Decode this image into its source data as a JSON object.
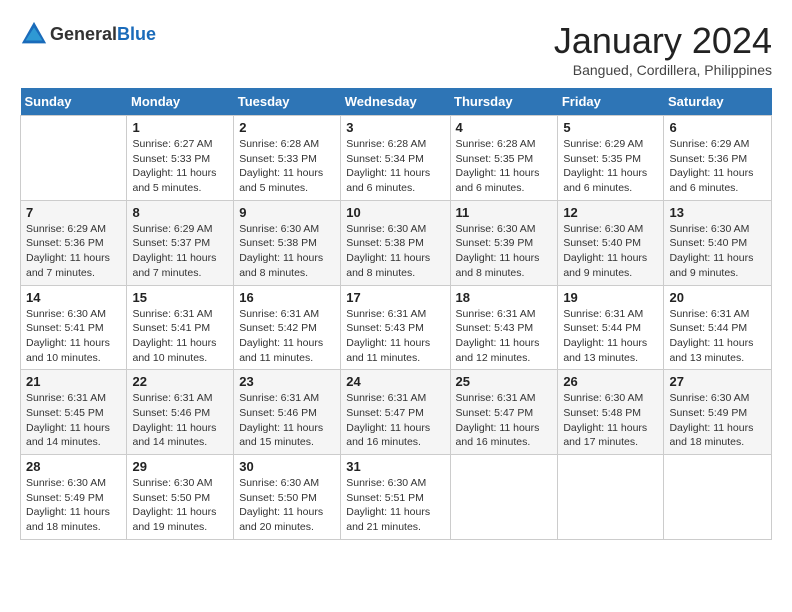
{
  "header": {
    "logo_general": "General",
    "logo_blue": "Blue",
    "month_year": "January 2024",
    "location": "Bangued, Cordillera, Philippines"
  },
  "weekdays": [
    "Sunday",
    "Monday",
    "Tuesday",
    "Wednesday",
    "Thursday",
    "Friday",
    "Saturday"
  ],
  "weeks": [
    [
      {
        "day": "",
        "sunrise": "",
        "sunset": "",
        "daylight": ""
      },
      {
        "day": "1",
        "sunrise": "Sunrise: 6:27 AM",
        "sunset": "Sunset: 5:33 PM",
        "daylight": "Daylight: 11 hours and 5 minutes."
      },
      {
        "day": "2",
        "sunrise": "Sunrise: 6:28 AM",
        "sunset": "Sunset: 5:33 PM",
        "daylight": "Daylight: 11 hours and 5 minutes."
      },
      {
        "day": "3",
        "sunrise": "Sunrise: 6:28 AM",
        "sunset": "Sunset: 5:34 PM",
        "daylight": "Daylight: 11 hours and 6 minutes."
      },
      {
        "day": "4",
        "sunrise": "Sunrise: 6:28 AM",
        "sunset": "Sunset: 5:35 PM",
        "daylight": "Daylight: 11 hours and 6 minutes."
      },
      {
        "day": "5",
        "sunrise": "Sunrise: 6:29 AM",
        "sunset": "Sunset: 5:35 PM",
        "daylight": "Daylight: 11 hours and 6 minutes."
      },
      {
        "day": "6",
        "sunrise": "Sunrise: 6:29 AM",
        "sunset": "Sunset: 5:36 PM",
        "daylight": "Daylight: 11 hours and 6 minutes."
      }
    ],
    [
      {
        "day": "7",
        "sunrise": "Sunrise: 6:29 AM",
        "sunset": "Sunset: 5:36 PM",
        "daylight": "Daylight: 11 hours and 7 minutes."
      },
      {
        "day": "8",
        "sunrise": "Sunrise: 6:29 AM",
        "sunset": "Sunset: 5:37 PM",
        "daylight": "Daylight: 11 hours and 7 minutes."
      },
      {
        "day": "9",
        "sunrise": "Sunrise: 6:30 AM",
        "sunset": "Sunset: 5:38 PM",
        "daylight": "Daylight: 11 hours and 8 minutes."
      },
      {
        "day": "10",
        "sunrise": "Sunrise: 6:30 AM",
        "sunset": "Sunset: 5:38 PM",
        "daylight": "Daylight: 11 hours and 8 minutes."
      },
      {
        "day": "11",
        "sunrise": "Sunrise: 6:30 AM",
        "sunset": "Sunset: 5:39 PM",
        "daylight": "Daylight: 11 hours and 8 minutes."
      },
      {
        "day": "12",
        "sunrise": "Sunrise: 6:30 AM",
        "sunset": "Sunset: 5:40 PM",
        "daylight": "Daylight: 11 hours and 9 minutes."
      },
      {
        "day": "13",
        "sunrise": "Sunrise: 6:30 AM",
        "sunset": "Sunset: 5:40 PM",
        "daylight": "Daylight: 11 hours and 9 minutes."
      }
    ],
    [
      {
        "day": "14",
        "sunrise": "Sunrise: 6:30 AM",
        "sunset": "Sunset: 5:41 PM",
        "daylight": "Daylight: 11 hours and 10 minutes."
      },
      {
        "day": "15",
        "sunrise": "Sunrise: 6:31 AM",
        "sunset": "Sunset: 5:41 PM",
        "daylight": "Daylight: 11 hours and 10 minutes."
      },
      {
        "day": "16",
        "sunrise": "Sunrise: 6:31 AM",
        "sunset": "Sunset: 5:42 PM",
        "daylight": "Daylight: 11 hours and 11 minutes."
      },
      {
        "day": "17",
        "sunrise": "Sunrise: 6:31 AM",
        "sunset": "Sunset: 5:43 PM",
        "daylight": "Daylight: 11 hours and 11 minutes."
      },
      {
        "day": "18",
        "sunrise": "Sunrise: 6:31 AM",
        "sunset": "Sunset: 5:43 PM",
        "daylight": "Daylight: 11 hours and 12 minutes."
      },
      {
        "day": "19",
        "sunrise": "Sunrise: 6:31 AM",
        "sunset": "Sunset: 5:44 PM",
        "daylight": "Daylight: 11 hours and 13 minutes."
      },
      {
        "day": "20",
        "sunrise": "Sunrise: 6:31 AM",
        "sunset": "Sunset: 5:44 PM",
        "daylight": "Daylight: 11 hours and 13 minutes."
      }
    ],
    [
      {
        "day": "21",
        "sunrise": "Sunrise: 6:31 AM",
        "sunset": "Sunset: 5:45 PM",
        "daylight": "Daylight: 11 hours and 14 minutes."
      },
      {
        "day": "22",
        "sunrise": "Sunrise: 6:31 AM",
        "sunset": "Sunset: 5:46 PM",
        "daylight": "Daylight: 11 hours and 14 minutes."
      },
      {
        "day": "23",
        "sunrise": "Sunrise: 6:31 AM",
        "sunset": "Sunset: 5:46 PM",
        "daylight": "Daylight: 11 hours and 15 minutes."
      },
      {
        "day": "24",
        "sunrise": "Sunrise: 6:31 AM",
        "sunset": "Sunset: 5:47 PM",
        "daylight": "Daylight: 11 hours and 16 minutes."
      },
      {
        "day": "25",
        "sunrise": "Sunrise: 6:31 AM",
        "sunset": "Sunset: 5:47 PM",
        "daylight": "Daylight: 11 hours and 16 minutes."
      },
      {
        "day": "26",
        "sunrise": "Sunrise: 6:30 AM",
        "sunset": "Sunset: 5:48 PM",
        "daylight": "Daylight: 11 hours and 17 minutes."
      },
      {
        "day": "27",
        "sunrise": "Sunrise: 6:30 AM",
        "sunset": "Sunset: 5:49 PM",
        "daylight": "Daylight: 11 hours and 18 minutes."
      }
    ],
    [
      {
        "day": "28",
        "sunrise": "Sunrise: 6:30 AM",
        "sunset": "Sunset: 5:49 PM",
        "daylight": "Daylight: 11 hours and 18 minutes."
      },
      {
        "day": "29",
        "sunrise": "Sunrise: 6:30 AM",
        "sunset": "Sunset: 5:50 PM",
        "daylight": "Daylight: 11 hours and 19 minutes."
      },
      {
        "day": "30",
        "sunrise": "Sunrise: 6:30 AM",
        "sunset": "Sunset: 5:50 PM",
        "daylight": "Daylight: 11 hours and 20 minutes."
      },
      {
        "day": "31",
        "sunrise": "Sunrise: 6:30 AM",
        "sunset": "Sunset: 5:51 PM",
        "daylight": "Daylight: 11 hours and 21 minutes."
      },
      {
        "day": "",
        "sunrise": "",
        "sunset": "",
        "daylight": ""
      },
      {
        "day": "",
        "sunrise": "",
        "sunset": "",
        "daylight": ""
      },
      {
        "day": "",
        "sunrise": "",
        "sunset": "",
        "daylight": ""
      }
    ]
  ]
}
